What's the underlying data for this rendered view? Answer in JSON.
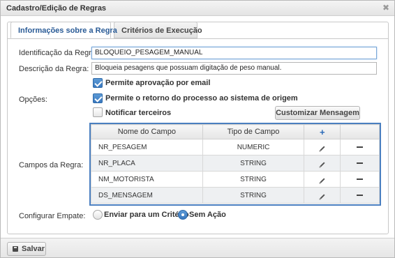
{
  "dialog": {
    "title": "Cadastro/Edição de Regras",
    "close_glyph": "✖"
  },
  "tabs": [
    {
      "label": "Informações sobre a Regra",
      "active": true
    },
    {
      "label": "Critérios de Execução",
      "active": false
    }
  ],
  "form": {
    "id_label": "Identificação da Regra:",
    "id_value": "BLOQUEIO_PESAGEM_MANUAL",
    "desc_label": "Descrição da Regra:",
    "desc_value": "Bloqueia pesagens que possuam digitação de peso manual.",
    "options_label": "Opções:",
    "options": [
      {
        "label": "Permite aprovação por email",
        "checked": true
      },
      {
        "label": "Permite o retorno do processo ao sistema de origem",
        "checked": true
      },
      {
        "label": "Notificar terceiros",
        "checked": false
      }
    ],
    "customize_button": "Customizar Mensagem",
    "fields_label": "Campos da Regra:",
    "tie_label": "Configurar Empate:",
    "tie_options": [
      {
        "label": "Enviar para um Critério",
        "selected": false
      },
      {
        "label": "Sem Ação",
        "selected": true
      }
    ]
  },
  "table": {
    "columns": [
      "Nome do Campo",
      "Tipo de Campo",
      "+",
      ""
    ],
    "rows": [
      {
        "name": "NR_PESAGEM",
        "type": "NUMERIC"
      },
      {
        "name": "NR_PLACA",
        "type": "STRING"
      },
      {
        "name": "NM_MOTORISTA",
        "type": "STRING"
      },
      {
        "name": "DS_MENSAGEM",
        "type": "STRING"
      }
    ]
  },
  "footer": {
    "save_label": "Salvar"
  },
  "colors": {
    "accent": "#3a79bf",
    "tab_active_text": "#2a5b96",
    "table_border": "#4a7fc0"
  }
}
